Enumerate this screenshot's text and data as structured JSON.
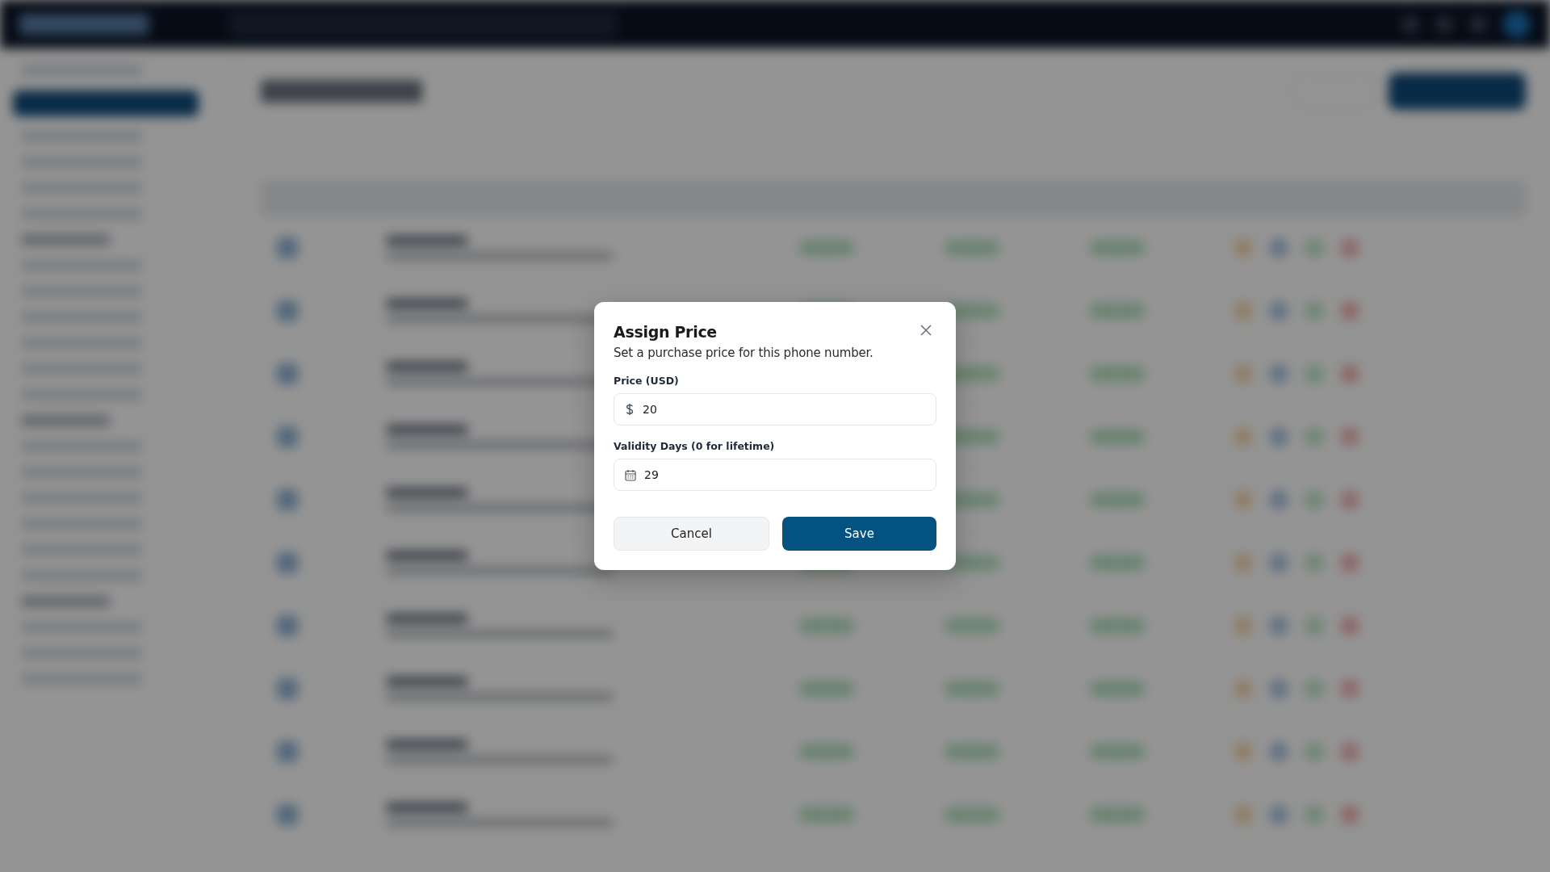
{
  "dialog": {
    "title": "Assign Price",
    "description": "Set a purchase price for this phone number.",
    "fields": [
      {
        "label": "Price (USD)",
        "value": "20",
        "kind": "currency"
      },
      {
        "label": "Validity Days (0 for lifetime)",
        "value": "29",
        "kind": "calendar"
      }
    ],
    "buttons": [
      {
        "label": "Cancel",
        "kind": "secondary"
      },
      {
        "label": "Save",
        "kind": "primary"
      }
    ]
  }
}
